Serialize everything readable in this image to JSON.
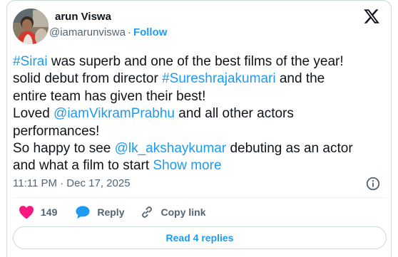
{
  "author": {
    "display_name": "arun Viswa",
    "handle": "@iamarunviswa",
    "separator": "·",
    "follow_label": "Follow"
  },
  "tweet": {
    "lines": [
      [
        {
          "text": "#Sirai",
          "link": true
        },
        {
          "text": " was superb and one of the best films of the year!",
          "link": false
        }
      ],
      [
        {
          "text": "solid debut from director ",
          "link": false
        },
        {
          "text": "#Sureshrajakumari",
          "link": true
        },
        {
          "text": " and the",
          "link": false
        }
      ],
      [
        {
          "text": "entire team has given their best!",
          "link": false
        }
      ],
      [
        {
          "text": "Loved ",
          "link": false
        },
        {
          "text": "@iamVikramPrabhu",
          "link": true
        },
        {
          "text": " and all other actors",
          "link": false
        }
      ],
      [
        {
          "text": "performances!",
          "link": false
        }
      ],
      [
        {
          "text": "So happy to see ",
          "link": false
        },
        {
          "text": "@lk_akshaykumar",
          "link": true
        },
        {
          "text": " debuting as an actor",
          "link": false
        }
      ],
      [
        {
          "text": "and what a film to start ",
          "link": false
        },
        {
          "text": "Show more",
          "link": true
        }
      ]
    ],
    "timestamp": "11:11 PM · Dec 17, 2025"
  },
  "actions": {
    "like_count": "149",
    "reply_label": "Reply",
    "copy_link_label": "Copy link"
  },
  "read_replies_label": "Read 4 replies",
  "colors": {
    "accent": "#1d9bf0",
    "like": "#f91880",
    "text": "#0f1419",
    "muted": "#536471",
    "border": "#cfd9de"
  },
  "icons": {
    "brand": "x-logo-icon",
    "info": "info-icon",
    "like": "heart-icon",
    "reply": "reply-bubble-icon",
    "copy": "link-icon"
  }
}
